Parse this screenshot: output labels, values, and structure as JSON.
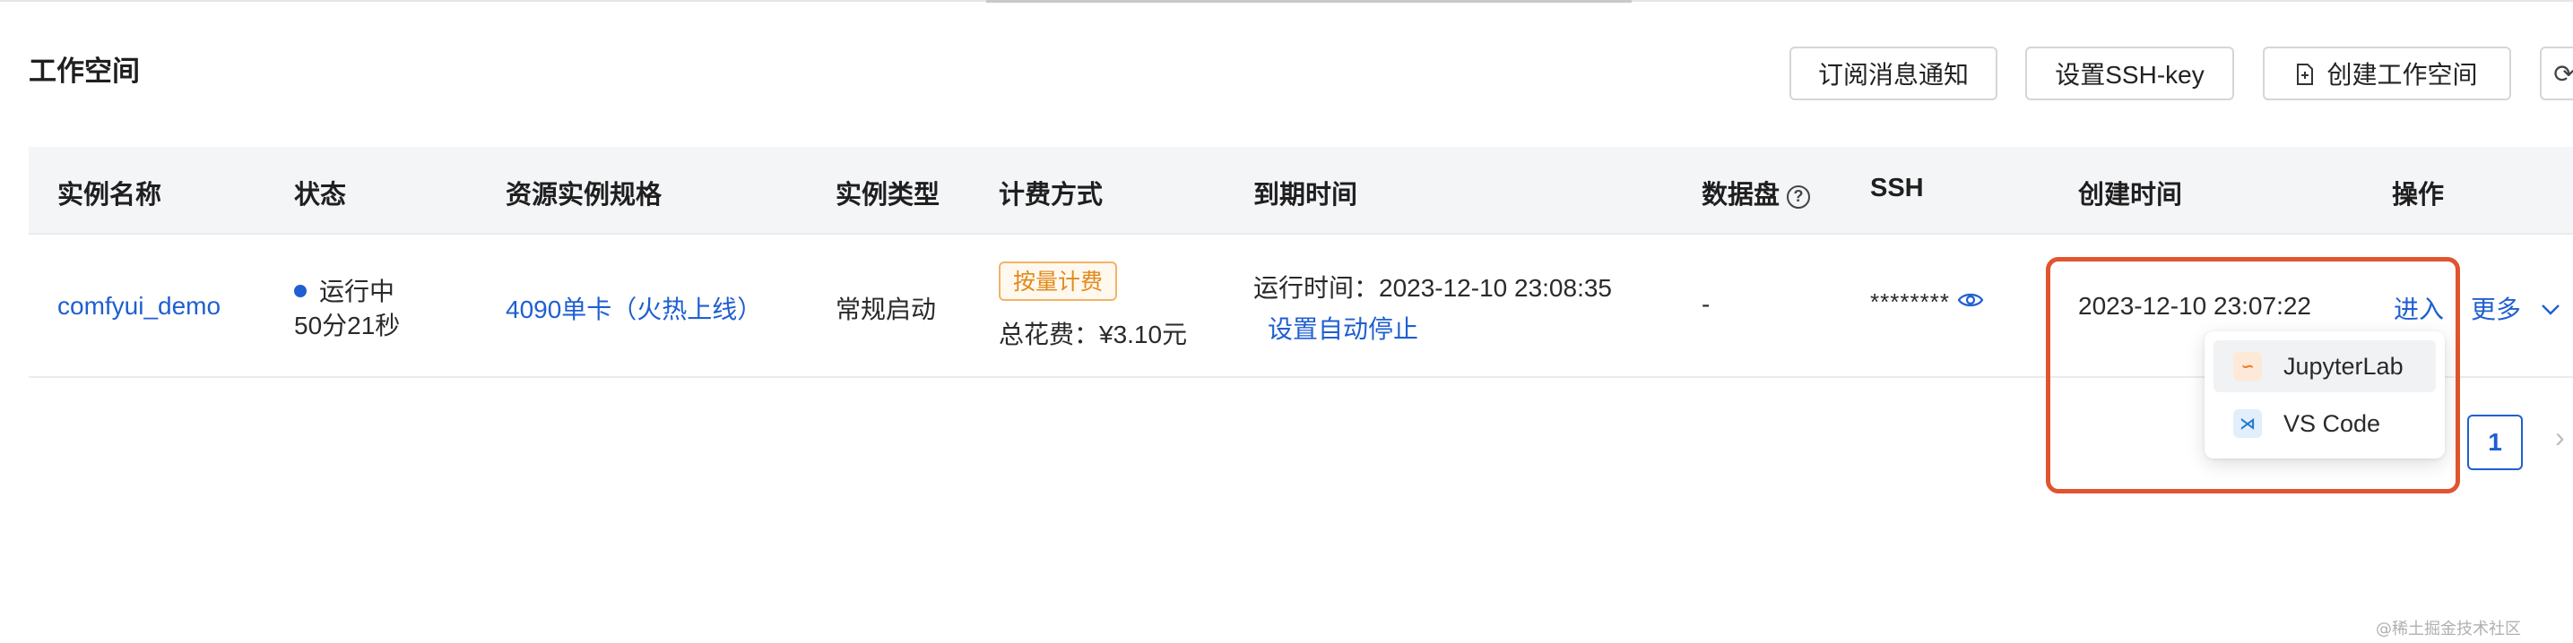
{
  "page": {
    "title": "工作空间"
  },
  "toolbar": {
    "subscribe_label": "订阅消息通知",
    "ssh_key_label": "设置SSH-key",
    "create_label": "创建工作空间",
    "refresh_icon": "refresh-icon",
    "create_icon": "file-plus-icon"
  },
  "table": {
    "columns": {
      "name": "实例名称",
      "status": "状态",
      "spec": "资源实例规格",
      "type": "实例类型",
      "billing": "计费方式",
      "expire": "到期时间",
      "disk": "数据盘",
      "ssh": "SSH",
      "created": "创建时间",
      "actions": "操作"
    },
    "rows": [
      {
        "name": "comfyui_demo",
        "status": "运行中",
        "status_duration": "50分21秒",
        "spec": "4090单卡（火热上线）",
        "type": "常规启动",
        "billing_tag": "按量计费",
        "total_cost": "总花费：¥3.10元",
        "run_time": "运行时间：2023-12-10 23:08:35",
        "auto_stop": "设置自动停止",
        "disk": "-",
        "ssh_masked": "********",
        "created": "2023-12-10 23:07:22",
        "enter": "进入",
        "more": "更多"
      }
    ]
  },
  "dropdown": {
    "items": [
      {
        "label": "JupyterLab",
        "icon": "jupyterlab-icon"
      },
      {
        "label": "VS Code",
        "icon": "vscode-icon"
      }
    ]
  },
  "pagination": {
    "current": "1"
  },
  "watermark": "@稀土掘金技术社区",
  "colors": {
    "link": "#1f5fd1",
    "highlight_border": "#e0542f",
    "billing_tag": "#e08a1c",
    "header_bg": "#f4f5f7"
  }
}
